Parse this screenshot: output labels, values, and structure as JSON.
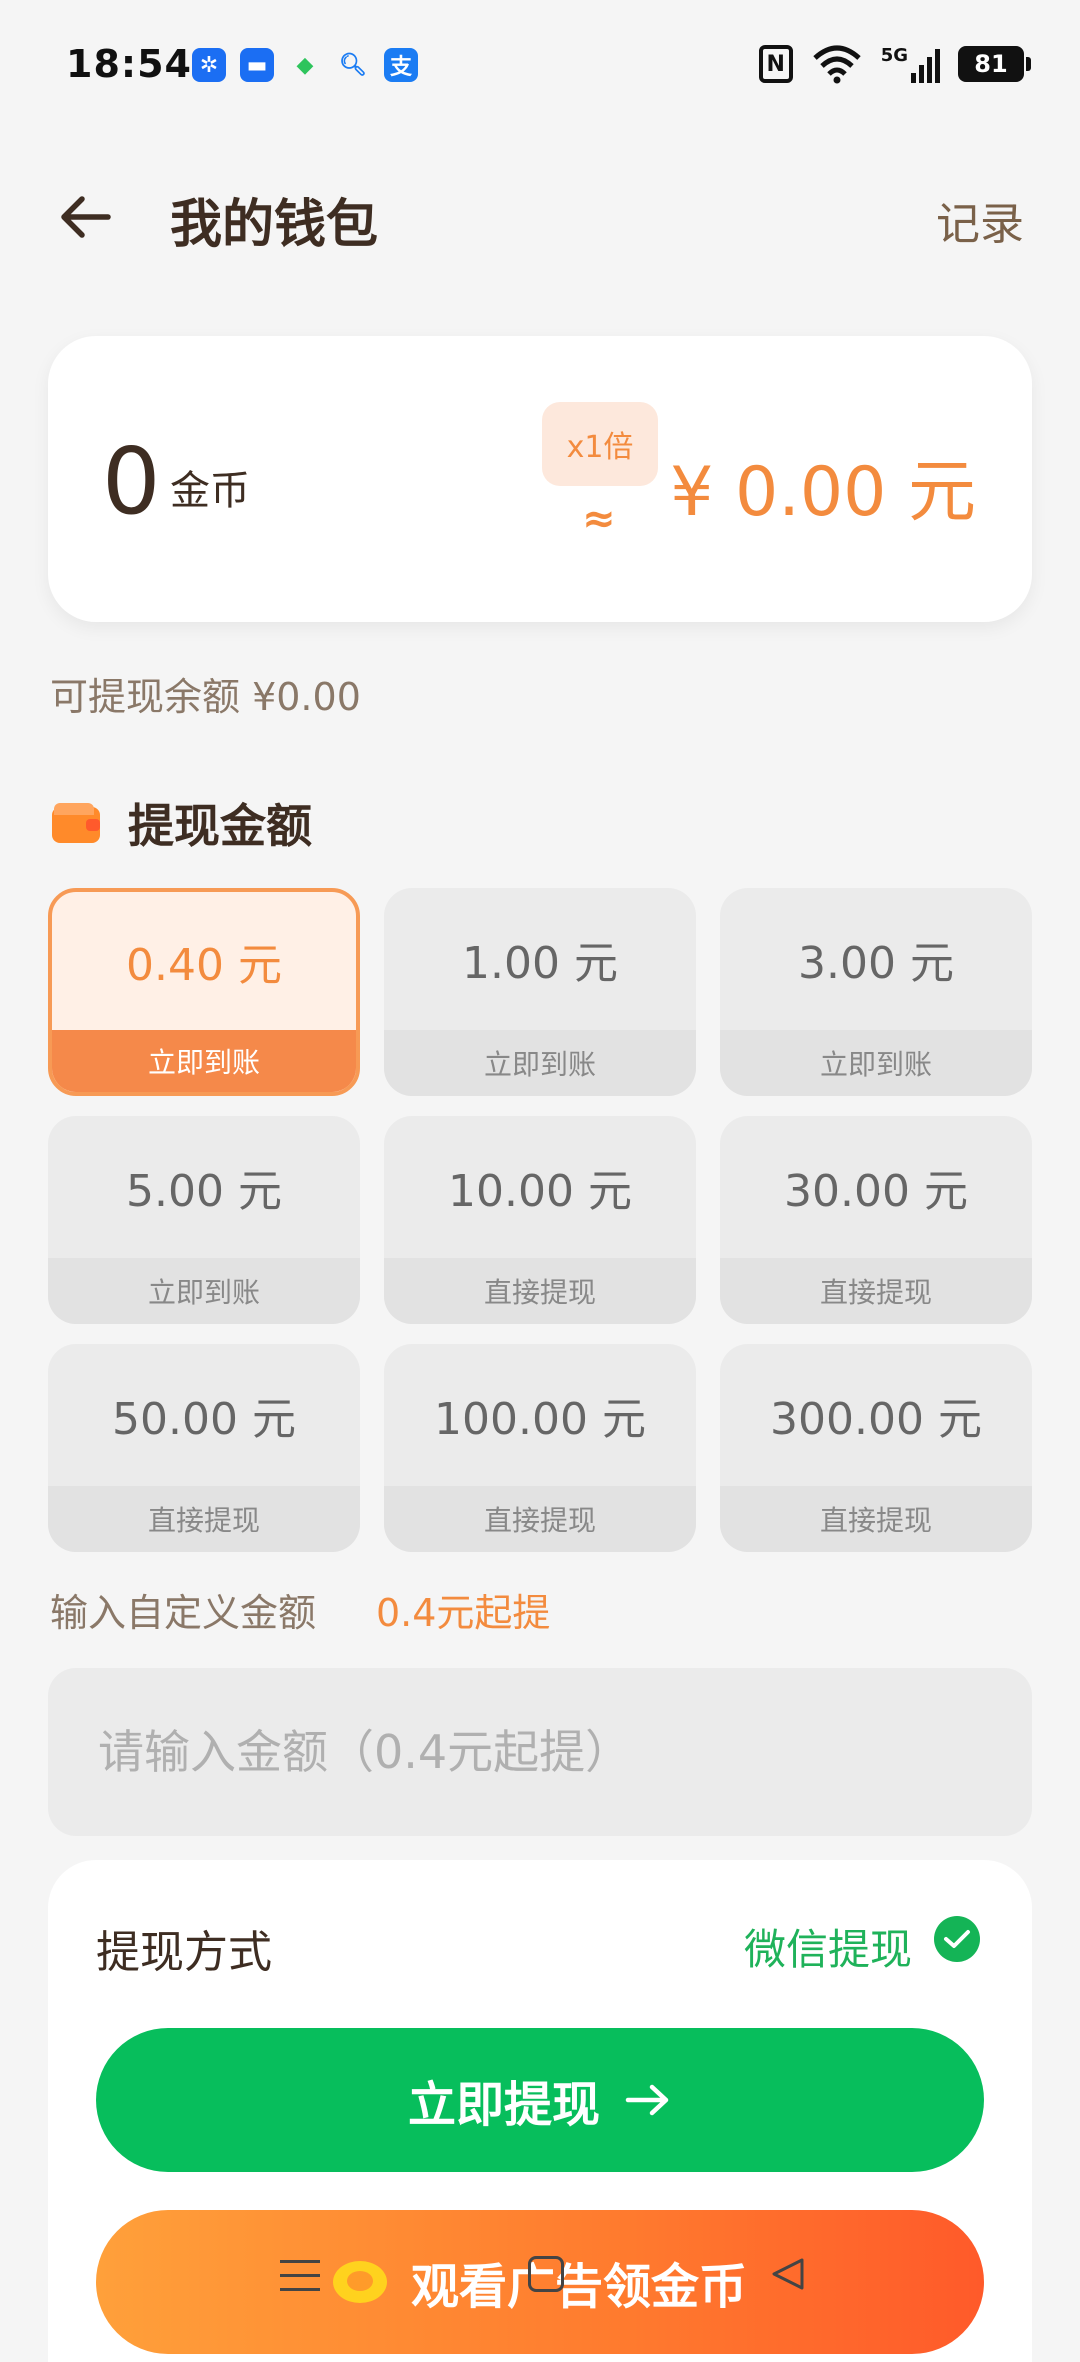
{
  "status_bar": {
    "time": "18:54",
    "notification_icons": [
      {
        "name": "pinwheel-app-icon",
        "glyph": "✲",
        "color": "#1b6ef3"
      },
      {
        "name": "messages-app-icon",
        "glyph": "▬",
        "color": "#1b6ef3"
      },
      {
        "name": "shield-app-icon",
        "glyph": "◆",
        "color": "#2ec45c"
      },
      {
        "name": "search-app-icon",
        "glyph": "Q",
        "color": "#ffffff"
      },
      {
        "name": "alipay-app-icon",
        "glyph": "支",
        "color": "#1b7cf3"
      }
    ],
    "network": "5G",
    "battery": "81"
  },
  "header": {
    "title": "我的钱包",
    "record_label": "记录"
  },
  "balance": {
    "coins": "0",
    "coin_unit": "金币",
    "multiplier": "x1倍",
    "approx": "≈",
    "money": "¥ 0.00 元"
  },
  "available": "可提现余额 ¥0.00",
  "withdraw_section": {
    "title": "提现金额",
    "options": [
      {
        "value": "0.40 元",
        "tag": "立即到账",
        "selected": true
      },
      {
        "value": "1.00 元",
        "tag": "立即到账",
        "selected": false
      },
      {
        "value": "3.00 元",
        "tag": "立即到账",
        "selected": false
      },
      {
        "value": "5.00 元",
        "tag": "立即到账",
        "selected": false
      },
      {
        "value": "10.00 元",
        "tag": "直接提现",
        "selected": false
      },
      {
        "value": "30.00 元",
        "tag": "直接提现",
        "selected": false
      },
      {
        "value": "50.00 元",
        "tag": "直接提现",
        "selected": false
      },
      {
        "value": "100.00 元",
        "tag": "直接提现",
        "selected": false
      },
      {
        "value": "300.00 元",
        "tag": "直接提现",
        "selected": false
      }
    ]
  },
  "custom": {
    "label": "输入自定义金额",
    "min_hint": "0.4元起提",
    "placeholder": "请输入金额（0.4元起提）"
  },
  "payout": {
    "method_label": "提现方式",
    "method_value": "微信提现",
    "withdraw_button": "立即提现",
    "ad_button": "观看广告领金币"
  },
  "colors": {
    "accent_orange": "#f38b3e",
    "wechat_green": "#07be5c",
    "text_brown": "#3e2d22"
  }
}
